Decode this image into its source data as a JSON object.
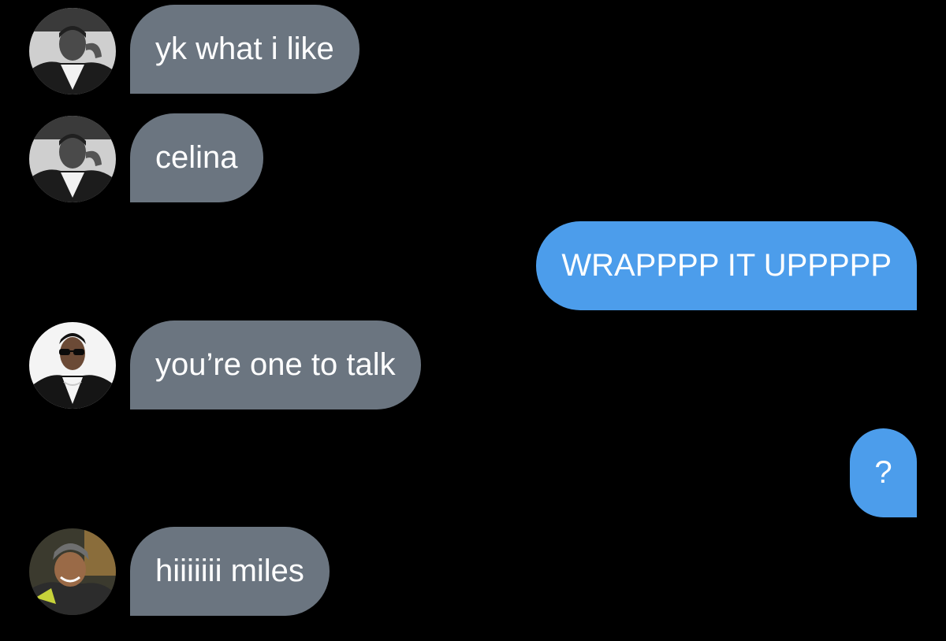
{
  "theme": {
    "background": "#000000",
    "incoming_bubble": "#6b7580",
    "outgoing_bubble": "#4c9deb",
    "text": "#ffffff"
  },
  "messages": [
    {
      "direction": "incoming",
      "text": "yk what i like",
      "avatar": "man-black-white-photo-avatar"
    },
    {
      "direction": "incoming",
      "text": "celina",
      "avatar": "man-black-white-photo-avatar"
    },
    {
      "direction": "outgoing",
      "text": "WRAPPPP IT UPPPPP"
    },
    {
      "direction": "incoming",
      "text": "you’re one to talk",
      "avatar": "man-sunglasses-photo-avatar"
    },
    {
      "direction": "outgoing",
      "text": "?"
    },
    {
      "direction": "incoming",
      "text": "hiiiiiii miles",
      "avatar": "woman-smiling-photo-avatar"
    }
  ]
}
